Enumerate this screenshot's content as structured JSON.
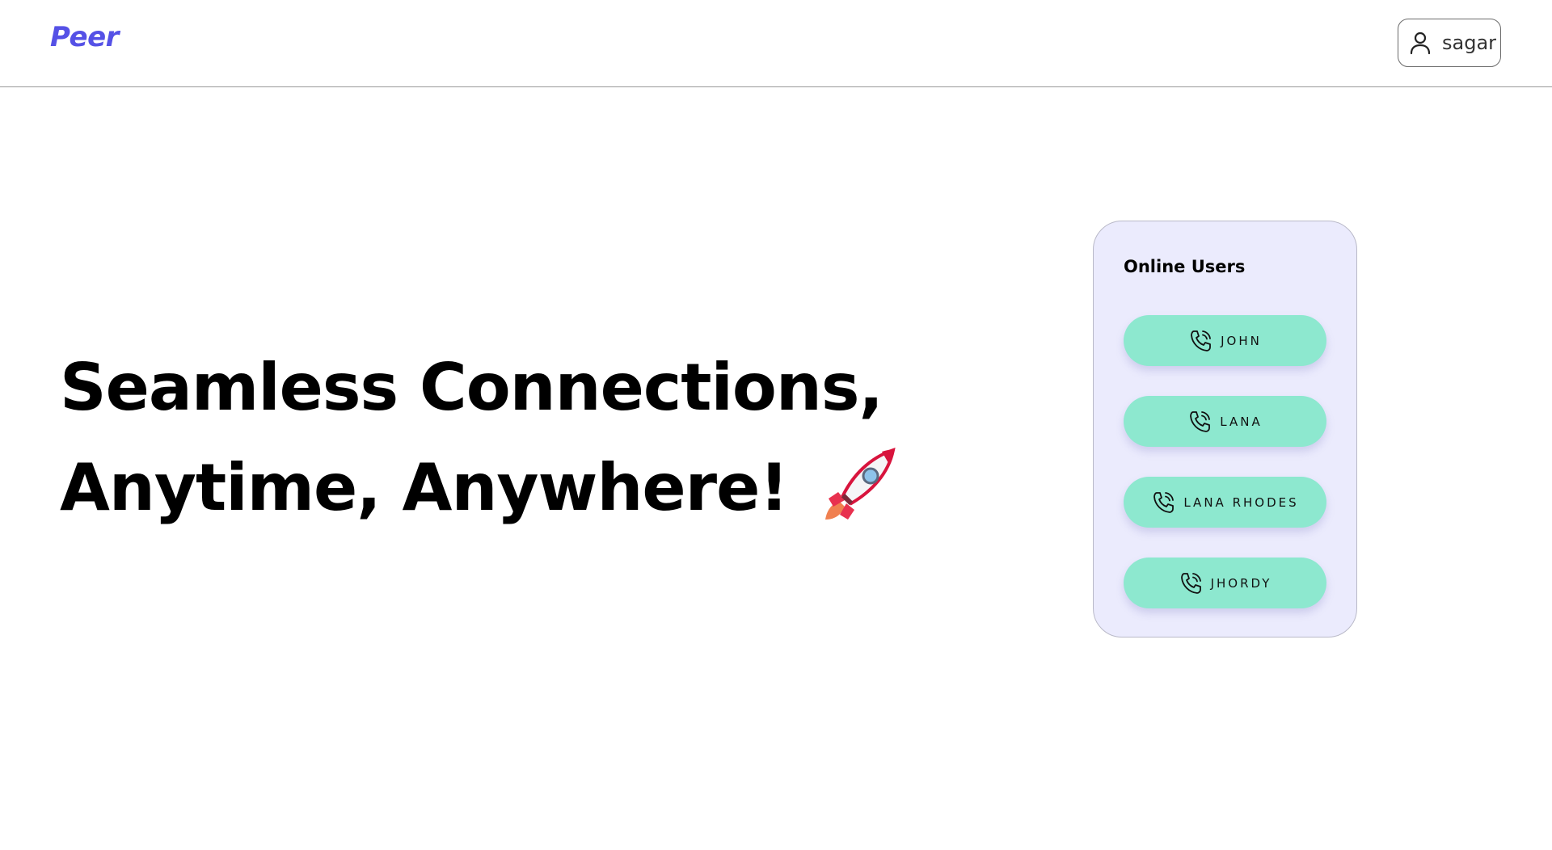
{
  "navbar": {
    "brand": "Peer",
    "user": {
      "icon": "user-icon",
      "name": "sagar"
    }
  },
  "hero": {
    "line1": "Seamless Connections,",
    "line2": "Anytime, Anywhere!",
    "emoji": "rocket-icon"
  },
  "online_panel": {
    "title": "Online Users",
    "users": [
      {
        "name": "JOHN",
        "icon": "phone-call-icon"
      },
      {
        "name": "LANA",
        "icon": "phone-call-icon"
      },
      {
        "name": "LANA RHODES",
        "icon": "phone-call-icon"
      },
      {
        "name": "JHORDY",
        "icon": "phone-call-icon"
      }
    ]
  },
  "colors": {
    "brand": "#5551e6",
    "panel_bg": "#ebebfd",
    "call_button": "#8de8cf"
  }
}
